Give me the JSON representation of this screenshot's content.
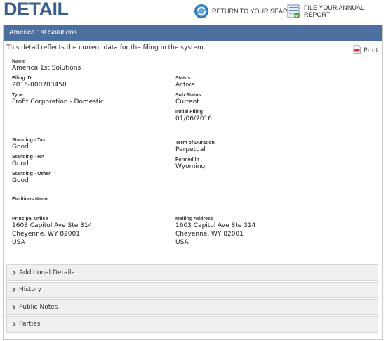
{
  "header": {
    "title": "DETAIL",
    "return_label": "RETURN TO YOUR SEARCH",
    "file_label": "FILE YOUR ANNUAL REPORT"
  },
  "panel": {
    "title": "America 1st Solutions",
    "intro": "This detail reflects the current data for the filing in the system.",
    "print_label": "Print"
  },
  "fields": {
    "name": {
      "label": "Name",
      "value": "America 1st Solutions"
    },
    "filing_id": {
      "label": "Filing ID",
      "value": "2016-000703450"
    },
    "status": {
      "label": "Status",
      "value": "Active"
    },
    "type": {
      "label": "Type",
      "value": "Profit Corporation - Domestic"
    },
    "sub_status": {
      "label": "Sub Status",
      "value": "Current"
    },
    "initial_filing": {
      "label": "Initial Filing",
      "value": "01/06/2016"
    },
    "standing_tax": {
      "label": "Standing - Tax",
      "value": "Good"
    },
    "term": {
      "label": "Term of Duration",
      "value": "Perpetual"
    },
    "standing_ra": {
      "label": "Standing - RA",
      "value": "Good"
    },
    "formed_in": {
      "label": "Formed In",
      "value": "Wyoming"
    },
    "standing_other": {
      "label": "Standing - Other",
      "value": "Good"
    },
    "fictitious_name": {
      "label": "Fictitious Name",
      "value": ""
    },
    "principal_office": {
      "label": "Principal Office",
      "line1": "1603 Capitol Ave Ste 314",
      "line2": "Cheyenne, WY 82001",
      "line3": "USA"
    },
    "mailing_address": {
      "label": "Mailing Address",
      "line1": "1603 Capitol Ave Ste 314",
      "line2": "Cheyenne, WY 82001",
      "line3": "USA"
    }
  },
  "sections": [
    "Additional Details",
    "History",
    "Public Notes",
    "Parties"
  ],
  "colors": {
    "brand": "#3a5e8e",
    "panel_header": "#4b6f9f"
  }
}
